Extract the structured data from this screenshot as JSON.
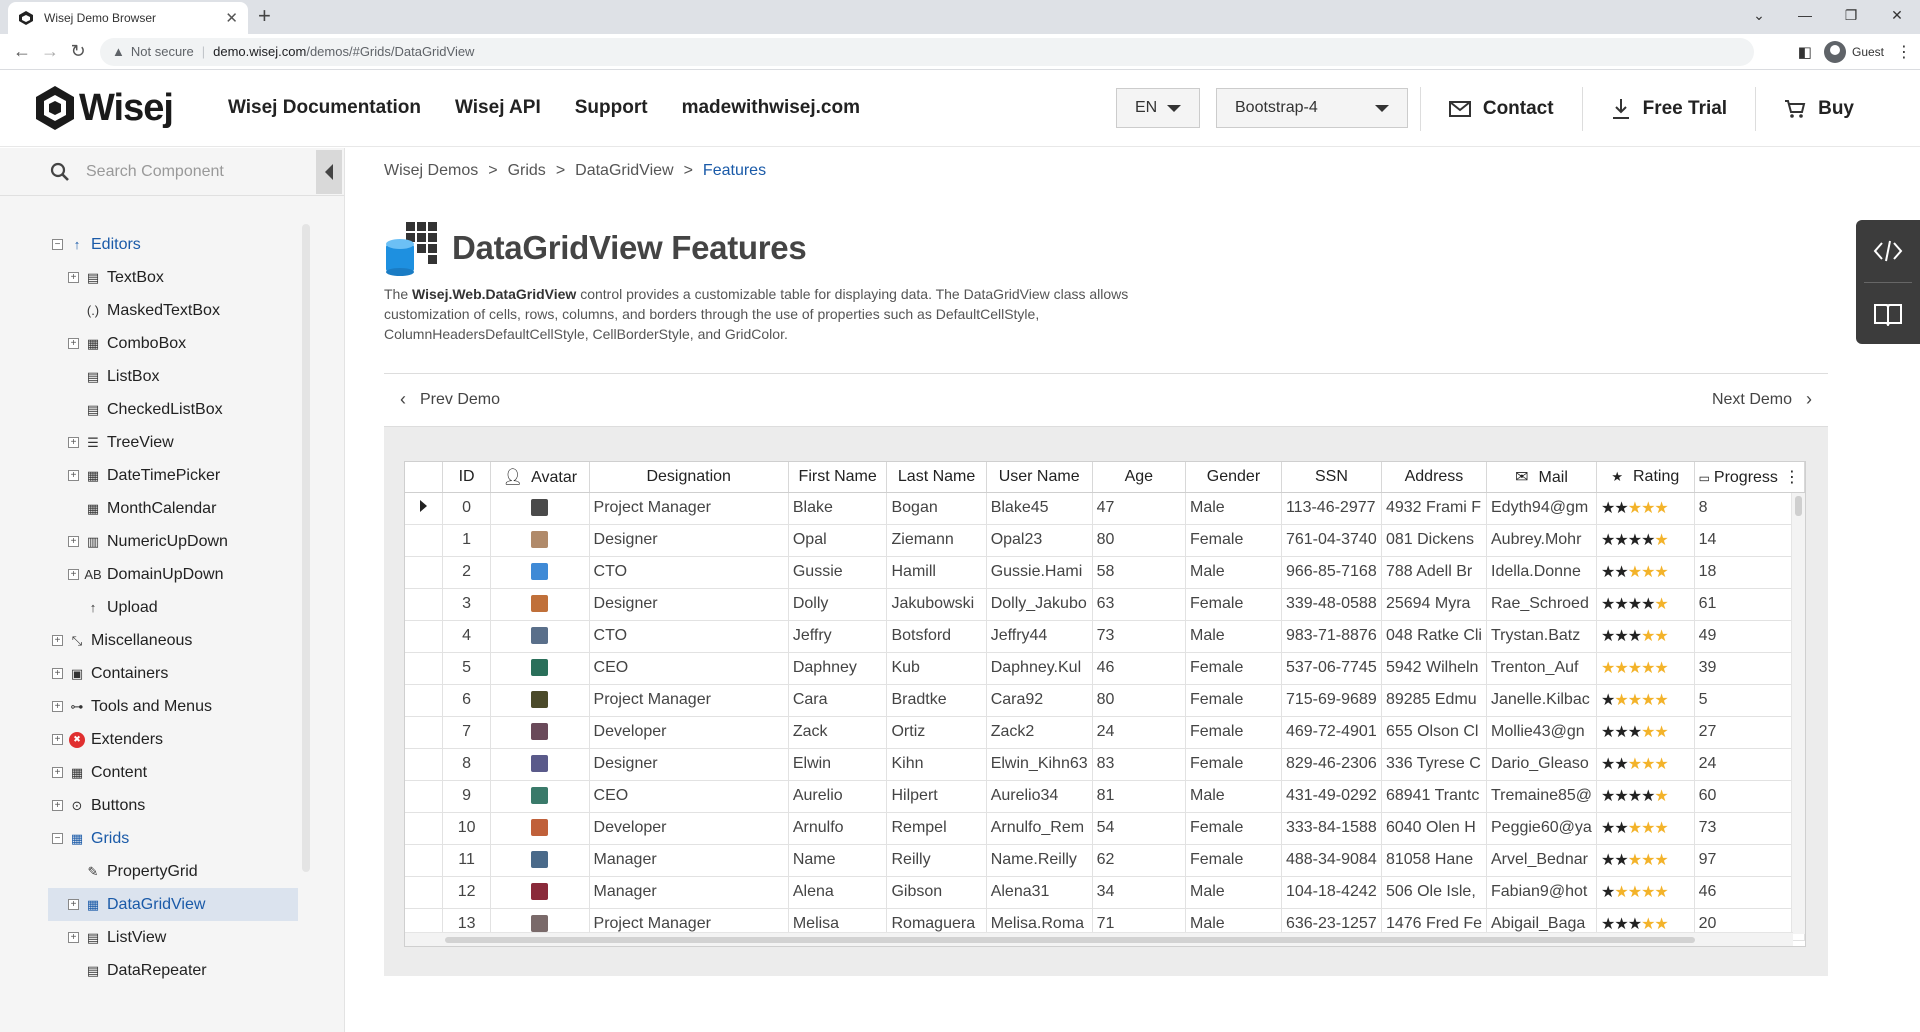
{
  "browser": {
    "tab_title": "Wisej Demo Browser",
    "not_secure": "Not secure",
    "url_host": "demo.wisej.com",
    "url_path": "/demos/#Grids/DataGridView",
    "profile": "Guest"
  },
  "header": {
    "logo": "Wisej",
    "nav": [
      "Wisej Documentation",
      "Wisej API",
      "Support",
      "madewithwisej.com"
    ],
    "language": "EN",
    "theme": "Bootstrap-4",
    "contact": "Contact",
    "free_trial": "Free Trial",
    "buy": "Buy"
  },
  "sidebar": {
    "search_placeholder": "Search Component",
    "items": [
      {
        "label": "Editors",
        "level": 0,
        "expander": "−",
        "icon": "up-arrow-icon",
        "glyph": "↑",
        "blue": true
      },
      {
        "label": "TextBox",
        "level": 1,
        "expander": "+",
        "icon": "textbox-icon",
        "glyph": "▤"
      },
      {
        "label": "MaskedTextBox",
        "level": 1,
        "expander": "",
        "icon": "masked-textbox-icon",
        "glyph": "(.)"
      },
      {
        "label": "ComboBox",
        "level": 1,
        "expander": "+",
        "icon": "combobox-icon",
        "glyph": "▦"
      },
      {
        "label": "ListBox",
        "level": 1,
        "expander": "",
        "icon": "listbox-icon",
        "glyph": "▤"
      },
      {
        "label": "CheckedListBox",
        "level": 1,
        "expander": "",
        "icon": "checked-listbox-icon",
        "glyph": "▤"
      },
      {
        "label": "TreeView",
        "level": 1,
        "expander": "+",
        "icon": "treeview-icon",
        "glyph": "☰"
      },
      {
        "label": "DateTimePicker",
        "level": 1,
        "expander": "+",
        "icon": "datetimepicker-icon",
        "glyph": "▦"
      },
      {
        "label": "MonthCalendar",
        "level": 1,
        "expander": "",
        "icon": "calendar-icon",
        "glyph": "▦"
      },
      {
        "label": "NumericUpDown",
        "level": 1,
        "expander": "+",
        "icon": "numeric-updown-icon",
        "glyph": "▥"
      },
      {
        "label": "DomainUpDown",
        "level": 1,
        "expander": "+",
        "icon": "domain-updown-icon",
        "glyph": "AB"
      },
      {
        "label": "Upload",
        "level": 1,
        "expander": "",
        "icon": "upload-icon",
        "glyph": "↑"
      },
      {
        "label": "Miscellaneous",
        "level": 0,
        "expander": "+",
        "icon": "misc-icon",
        "glyph": "⤡"
      },
      {
        "label": "Containers",
        "level": 0,
        "expander": "+",
        "icon": "containers-icon",
        "glyph": "▣"
      },
      {
        "label": "Tools and Menus",
        "level": 0,
        "expander": "+",
        "icon": "tools-menus-icon",
        "glyph": "⊶"
      },
      {
        "label": "Extenders",
        "level": 0,
        "expander": "+",
        "icon": "extenders-icon",
        "glyph": "✖"
      },
      {
        "label": "Content",
        "level": 0,
        "expander": "+",
        "icon": "content-icon",
        "glyph": "▦"
      },
      {
        "label": "Buttons",
        "level": 0,
        "expander": "+",
        "icon": "buttons-icon",
        "glyph": "⊙"
      },
      {
        "label": "Grids",
        "level": 0,
        "expander": "−",
        "icon": "grids-icon",
        "glyph": "▦",
        "blue": true
      },
      {
        "label": "PropertyGrid",
        "level": 1,
        "expander": "",
        "icon": "propertygrid-icon",
        "glyph": "✎"
      },
      {
        "label": "DataGridView",
        "level": 1,
        "expander": "+",
        "icon": "datagridview-icon",
        "glyph": "▦",
        "selected": true
      },
      {
        "label": "ListView",
        "level": 1,
        "expander": "+",
        "icon": "listview-icon",
        "glyph": "▤"
      },
      {
        "label": "DataRepeater",
        "level": 1,
        "expander": "",
        "icon": "datarepeater-icon",
        "glyph": "▤"
      }
    ]
  },
  "breadcrumb": [
    "Wisej Demos",
    "Grids",
    "DataGridView",
    "Features"
  ],
  "page": {
    "title": "DataGridView Features",
    "desc_prefix": "The ",
    "desc_bold": "Wisej.Web.DataGridView",
    "desc_rest": " control provides a customizable table for displaying data. The DataGridView class allows customization of cells, rows, columns, and borders through the use of properties such as DefaultCellStyle, ColumnHeadersDefaultCellStyle, CellBorderStyle, and GridColor.",
    "prev": "Prev Demo",
    "next": "Next Demo"
  },
  "grid": {
    "columns": [
      "",
      "ID",
      "Avatar",
      "Designation",
      "First Name",
      "Last Name",
      "User Name",
      "Age",
      "Gender",
      "SSN",
      "Address",
      "Mail",
      "Rating",
      "Progress"
    ],
    "rows": [
      {
        "id": "0",
        "avatar_color": "#4a4a4a",
        "designation": "Project Manager",
        "first": "Blake",
        "last": "Bogan",
        "user": "Blake45",
        "age": "47",
        "gender": "Male",
        "ssn": "113-46-2977",
        "address": "4932 Frami F",
        "mail": "Edyth94@gm",
        "rating": 2,
        "progress": "8"
      },
      {
        "id": "1",
        "avatar_color": "#b08a6a",
        "designation": "Designer",
        "first": "Opal",
        "last": "Ziemann",
        "user": "Opal23",
        "age": "80",
        "gender": "Female",
        "ssn": "761-04-3740",
        "address": "081 Dickens",
        "mail": "Aubrey.Mohr",
        "rating": 4,
        "progress": "14"
      },
      {
        "id": "2",
        "avatar_color": "#3f8ad6",
        "designation": "CTO",
        "first": "Gussie",
        "last": "Hamill",
        "user": "Gussie.Hami",
        "age": "58",
        "gender": "Male",
        "ssn": "966-85-7168",
        "address": "788 Adell Br",
        "mail": "Idella.Donne",
        "rating": 2,
        "progress": "18"
      },
      {
        "id": "3",
        "avatar_color": "#c0703a",
        "designation": "Designer",
        "first": "Dolly",
        "last": "Jakubowski",
        "user": "Dolly_Jakubo",
        "age": "63",
        "gender": "Female",
        "ssn": "339-48-0588",
        "address": "25694 Myra",
        "mail": "Rae_Schroed",
        "rating": 4,
        "progress": "61"
      },
      {
        "id": "4",
        "avatar_color": "#5a6f8a",
        "designation": "CTO",
        "first": "Jeffry",
        "last": "Botsford",
        "user": "Jeffry44",
        "age": "73",
        "gender": "Male",
        "ssn": "983-71-8876",
        "address": "048 Ratke Cli",
        "mail": "Trystan.Batz",
        "rating": 3,
        "progress": "49"
      },
      {
        "id": "5",
        "avatar_color": "#2a6f5a",
        "designation": "CEO",
        "first": "Daphney",
        "last": "Kub",
        "user": "Daphney.Kul",
        "age": "46",
        "gender": "Female",
        "ssn": "537-06-7745",
        "address": "5942 Wilheln",
        "mail": "Trenton_Auf",
        "rating": 0,
        "progress": "39"
      },
      {
        "id": "6",
        "avatar_color": "#4b4a2a",
        "designation": "Project Manager",
        "first": "Cara",
        "last": "Bradtke",
        "user": "Cara92",
        "age": "80",
        "gender": "Female",
        "ssn": "715-69-9689",
        "address": "89285 Edmu",
        "mail": "Janelle.Kilbac",
        "rating": 1,
        "progress": "5"
      },
      {
        "id": "7",
        "avatar_color": "#6a4a5a",
        "designation": "Developer",
        "first": "Zack",
        "last": "Ortiz",
        "user": "Zack2",
        "age": "24",
        "gender": "Female",
        "ssn": "469-72-4901",
        "address": "655 Olson Cl",
        "mail": "Mollie43@gn",
        "rating": 3,
        "progress": "27"
      },
      {
        "id": "8",
        "avatar_color": "#5a5a8a",
        "designation": "Designer",
        "first": "Elwin",
        "last": "Kihn",
        "user": "Elwin_Kihn63",
        "age": "83",
        "gender": "Female",
        "ssn": "829-46-2306",
        "address": "336 Tyrese C",
        "mail": "Dario_Gleaso",
        "rating": 2,
        "progress": "24"
      },
      {
        "id": "9",
        "avatar_color": "#3a7a6a",
        "designation": "CEO",
        "first": "Aurelio",
        "last": "Hilpert",
        "user": "Aurelio34",
        "age": "81",
        "gender": "Male",
        "ssn": "431-49-0292",
        "address": "68941 Trantc",
        "mail": "Tremaine85@",
        "rating": 4,
        "progress": "60"
      },
      {
        "id": "10",
        "avatar_color": "#c0603a",
        "designation": "Developer",
        "first": "Arnulfo",
        "last": "Rempel",
        "user": "Arnulfo_Rem",
        "age": "54",
        "gender": "Female",
        "ssn": "333-84-1588",
        "address": "6040 Olen H",
        "mail": "Peggie60@ya",
        "rating": 2,
        "progress": "73"
      },
      {
        "id": "11",
        "avatar_color": "#4a6a8a",
        "designation": "Manager",
        "first": "Name",
        "last": "Reilly",
        "user": "Name.Reilly",
        "age": "62",
        "gender": "Female",
        "ssn": "488-34-9084",
        "address": "81058 Hane",
        "mail": "Arvel_Bednar",
        "rating": 2,
        "progress": "97"
      },
      {
        "id": "12",
        "avatar_color": "#8a2a3a",
        "designation": "Manager",
        "first": "Alena",
        "last": "Gibson",
        "user": "Alena31",
        "age": "34",
        "gender": "Male",
        "ssn": "104-18-4242",
        "address": "506 Ole Isle,",
        "mail": "Fabian9@hot",
        "rating": 1,
        "progress": "46"
      },
      {
        "id": "13",
        "avatar_color": "#7a6a6a",
        "designation": "Project Manager",
        "first": "Melisa",
        "last": "Romaguera",
        "user": "Melisa.Roma",
        "age": "71",
        "gender": "Male",
        "ssn": "636-23-1257",
        "address": "1476 Fred Fe",
        "mail": "Abigail_Baga",
        "rating": 3,
        "progress": "20"
      }
    ]
  },
  "colors": {
    "accent": "#1a5aa8",
    "star_on": "#222222",
    "star_off": "#f3b32a",
    "cylinder": "#1e90e0"
  }
}
